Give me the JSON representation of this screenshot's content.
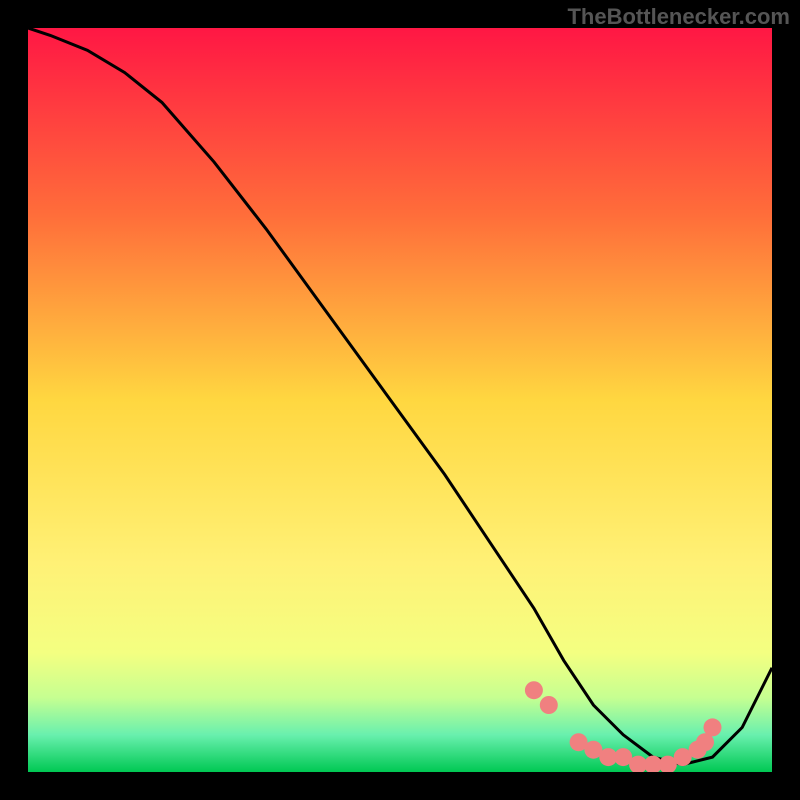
{
  "watermark": "TheBottlenecker.com",
  "chart_data": {
    "type": "line",
    "title": "",
    "xlabel": "",
    "ylabel": "",
    "xlim": [
      0,
      100
    ],
    "ylim": [
      0,
      100
    ],
    "background_gradient": {
      "stops": [
        {
          "offset": 0,
          "color": "#ff1744"
        },
        {
          "offset": 25,
          "color": "#ff6d3a"
        },
        {
          "offset": 50,
          "color": "#ffd740"
        },
        {
          "offset": 72,
          "color": "#fff176"
        },
        {
          "offset": 84,
          "color": "#f4ff81"
        },
        {
          "offset": 90,
          "color": "#c6ff91"
        },
        {
          "offset": 95,
          "color": "#69f0ae"
        },
        {
          "offset": 100,
          "color": "#00c853"
        }
      ]
    },
    "series": [
      {
        "name": "curve",
        "type": "line",
        "x": [
          0,
          3,
          8,
          13,
          18,
          25,
          32,
          40,
          48,
          56,
          62,
          68,
          72,
          76,
          80,
          84,
          88,
          92,
          96,
          100
        ],
        "y": [
          100,
          99,
          97,
          94,
          90,
          82,
          73,
          62,
          51,
          40,
          31,
          22,
          15,
          9,
          5,
          2,
          1,
          2,
          6,
          14
        ]
      },
      {
        "name": "markers",
        "type": "scatter",
        "x": [
          68,
          70,
          74,
          76,
          78,
          80,
          82,
          84,
          86,
          88,
          90,
          91,
          92
        ],
        "y": [
          11,
          9,
          4,
          3,
          2,
          2,
          1,
          1,
          1,
          2,
          3,
          4,
          6
        ]
      }
    ],
    "marker_color": "#f08080",
    "line_color": "#000000"
  }
}
